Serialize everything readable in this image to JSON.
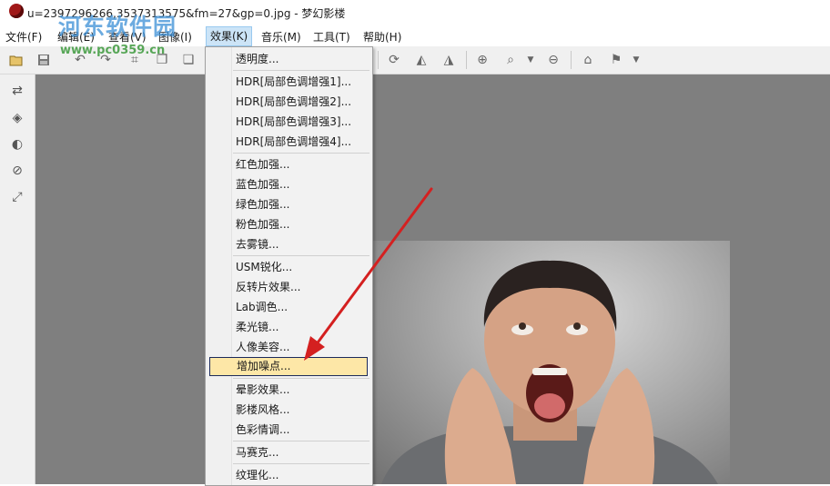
{
  "window": {
    "title": "u=2397296266,3537313575&fm=27&gp=0.jpg - 梦幻影楼"
  },
  "watermark": {
    "text": "河东软件园",
    "url": "www.pc0359.cn"
  },
  "menubar": {
    "items": [
      "文件(F)",
      "编辑(E)",
      "查看(V)",
      "图像(I)",
      "效果(K)",
      "音乐(M)",
      "工具(T)",
      "帮助(H)"
    ]
  },
  "effects_menu": {
    "items": [
      "透明度...",
      "HDR[局部色调增强1]...",
      "HDR[局部色调增强2]...",
      "HDR[局部色调增强3]...",
      "HDR[局部色调增强4]...",
      "红色加强...",
      "蓝色加强...",
      "绿色加强...",
      "粉色加强...",
      "去雾镜...",
      "USM锐化...",
      "反转片效果...",
      "Lab调色...",
      "柔光镜...",
      "人像美容...",
      "增加噪点...",
      "晕影效果...",
      "影楼风格...",
      "色彩情调...",
      "马赛克...",
      "纹理化..."
    ],
    "highlighted": "增加噪点..."
  },
  "icons": {
    "toolbar": [
      "open-icon",
      "save-icon",
      "undo-icon",
      "redo-icon",
      "crop-icon",
      "copy-icon",
      "paste-icon",
      "rotate-icon",
      "flip-horizontal-icon",
      "flip-vertical-icon",
      "zoom-in-icon",
      "zoom-icon",
      "zoom-out-icon",
      "home-icon",
      "flag-icon"
    ],
    "sidebar": [
      "swap-icon",
      "layers-icon",
      "contrast-icon",
      "brush-icon",
      "fullscreen-icon"
    ]
  },
  "colors": {
    "canvas": "#7f7f7f",
    "menu_highlight": "#fde7a7",
    "arrow": "#d42020",
    "watermark": "#3b8fd6"
  }
}
